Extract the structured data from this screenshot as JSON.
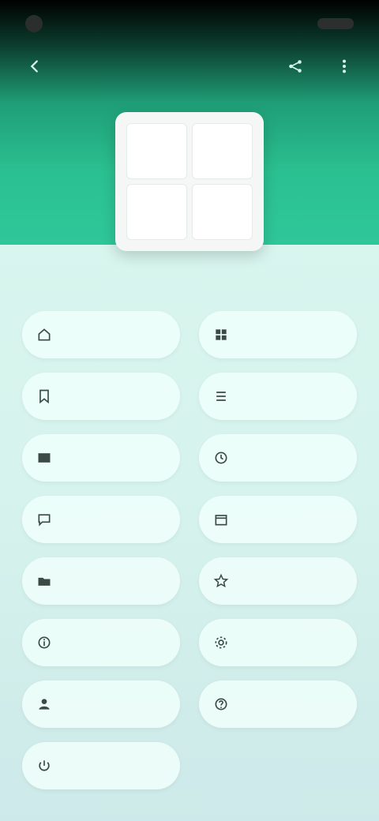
{
  "status_bar": {
    "time": "",
    "indicators": ""
  },
  "topbar": {
    "back_icon": "back-icon",
    "actions": [
      "share-icon",
      "more-icon"
    ]
  },
  "app": {
    "title": ""
  },
  "menu": [
    {
      "label": "",
      "icon": "home-icon"
    },
    {
      "label": "",
      "icon": "grid-icon"
    },
    {
      "label": "",
      "icon": "bookmark-icon"
    },
    {
      "label": "",
      "icon": "list-icon"
    },
    {
      "label": "",
      "icon": "image-icon"
    },
    {
      "label": "",
      "icon": "clock-icon"
    },
    {
      "label": "",
      "icon": "chat-icon"
    },
    {
      "label": "",
      "icon": "calendar-icon"
    },
    {
      "label": "",
      "icon": "folder-icon"
    },
    {
      "label": "",
      "icon": "star-icon"
    },
    {
      "label": "",
      "icon": "info-icon"
    },
    {
      "label": "",
      "icon": "settings-icon"
    },
    {
      "label": "",
      "icon": "user-icon"
    },
    {
      "label": "",
      "icon": "help-icon"
    },
    {
      "label": "",
      "icon": "power-icon"
    }
  ]
}
